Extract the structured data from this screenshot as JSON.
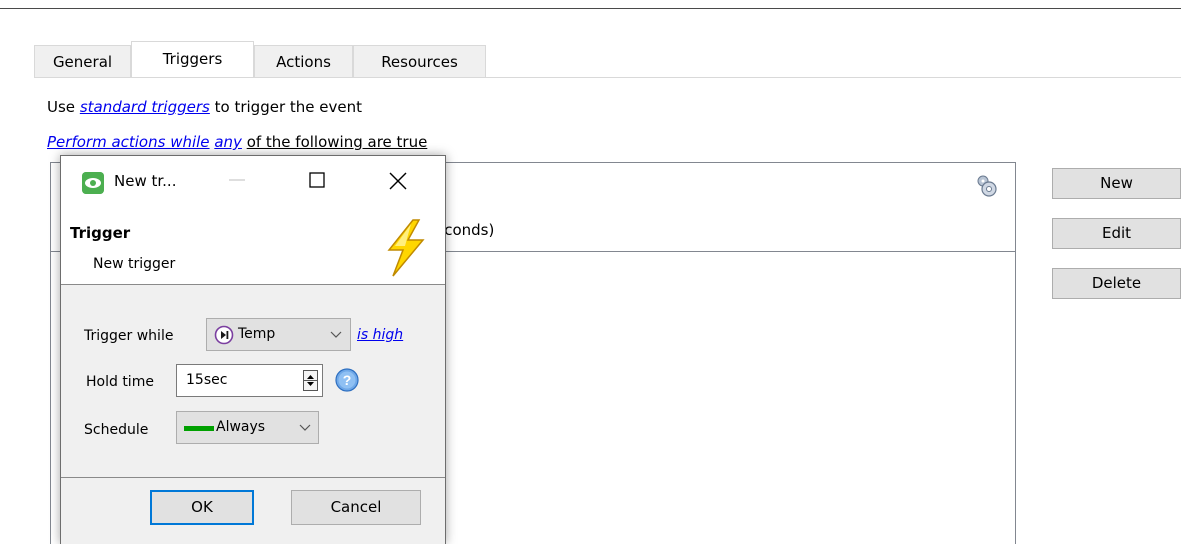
{
  "tabs": [
    {
      "label": "General",
      "active": false
    },
    {
      "label": "Triggers",
      "active": true
    },
    {
      "label": "Actions",
      "active": false
    },
    {
      "label": "Resources",
      "active": false
    }
  ],
  "trigger_config": {
    "use_prefix": "Use",
    "standard_triggers_link": "standard triggers",
    "use_suffix": "to trigger the event",
    "perform_link": "Perform actions while",
    "any_link": "any",
    "perform_suffix": "of the following are true"
  },
  "list": {
    "row_text_visible": "econds)",
    "gear_icon": "gear-icon"
  },
  "right_buttons": {
    "new": "New",
    "edit": "Edit",
    "delete": "Delete"
  },
  "dialog": {
    "title": "New tr...",
    "header_title": "Trigger",
    "header_subtitle": "New trigger",
    "trigger_while_label": "Trigger while",
    "trigger_while_value": "Temp",
    "condition_link": "is high",
    "hold_time_label": "Hold time",
    "hold_time_value": "15sec",
    "schedule_label": "Schedule",
    "schedule_value": "Always",
    "ok_label": "OK",
    "cancel_label": "Cancel"
  },
  "colors": {
    "link": "#0000ee",
    "schedule_swatch": "#00a000",
    "ok_border": "#0078d7"
  }
}
